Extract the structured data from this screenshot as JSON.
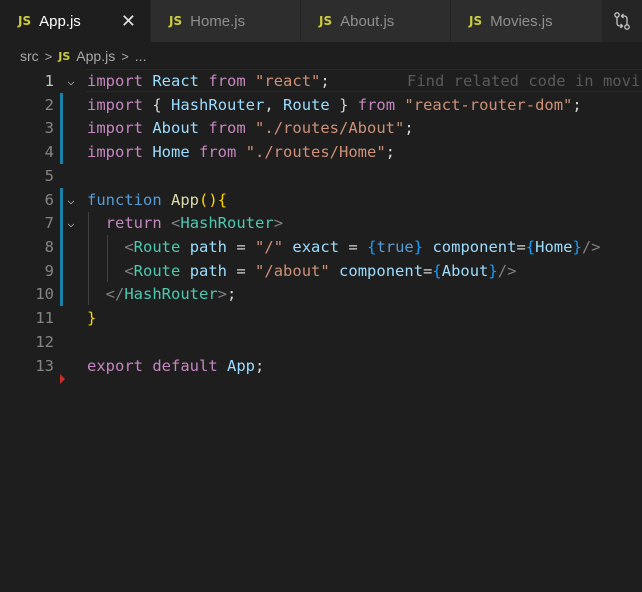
{
  "tabs": [
    {
      "icon": "JS",
      "label": "App.js",
      "active": true,
      "close": "✕"
    },
    {
      "icon": "JS",
      "label": "Home.js",
      "active": false
    },
    {
      "icon": "JS",
      "label": "About.js",
      "active": false
    },
    {
      "icon": "JS",
      "label": "Movies.js",
      "active": false
    }
  ],
  "breadcrumb": {
    "folder": "src",
    "icon": "JS",
    "file": "App.js",
    "more": "..."
  },
  "ghost_text": "Find related code in movi",
  "line_numbers": [
    "1",
    "2",
    "3",
    "4",
    "5",
    "6",
    "7",
    "8",
    "9",
    "10",
    "11",
    "12",
    "13"
  ],
  "code": {
    "l1": [
      "import",
      "React",
      "from",
      "\"react\"",
      ";"
    ],
    "l2": [
      "import",
      "{",
      "HashRouter",
      ",",
      "Route",
      "}",
      "from",
      "\"react-router-dom\"",
      ";"
    ],
    "l3": [
      "import",
      "About",
      "from",
      "\"./routes/About\"",
      ";"
    ],
    "l4": [
      "import",
      "Home",
      "from",
      "\"./routes/Home\"",
      ";"
    ],
    "l6": [
      "function",
      "App",
      "(",
      ")",
      "{"
    ],
    "l7": [
      "return",
      "<",
      "HashRouter",
      ">"
    ],
    "l8": [
      "<",
      "Route",
      "path",
      "=",
      "\"/\"",
      "exact",
      "=",
      "{",
      "true",
      "}",
      "component",
      "=",
      "{",
      "Home",
      "}",
      "/>"
    ],
    "l9": [
      "<",
      "Route",
      "path",
      "=",
      "\"/about\"",
      "component",
      "=",
      "{",
      "About",
      "}",
      "/>"
    ],
    "l10": [
      "</",
      "HashRouter",
      ">",
      ";"
    ],
    "l11": [
      "}"
    ],
    "l13": [
      "export",
      "default",
      "App",
      ";"
    ]
  }
}
